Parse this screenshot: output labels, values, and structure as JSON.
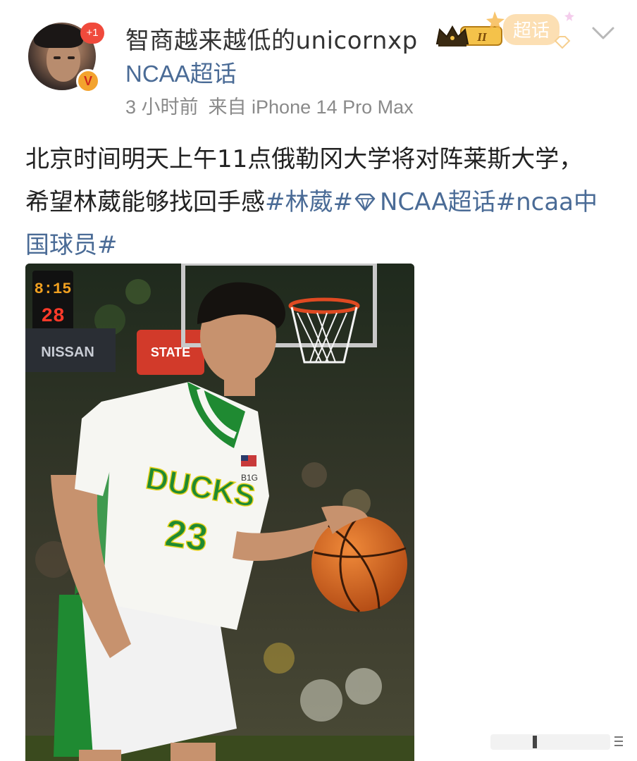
{
  "header": {
    "avatar_badge": "+1",
    "verified_badge": "V",
    "username": "智商越来越低的unicornxp",
    "crown_level": "II",
    "supertopic_tag": "超话",
    "topic": "NCAA超话",
    "time": "3 小时前",
    "source": "来自 iPhone 14 Pro Max"
  },
  "post": {
    "text": "北京时间明天上午11点俄勒冈大学将对阵莱斯大学，希望林葳能够找回手感",
    "tag1": "#林葳#",
    "tag2": "NCAA超话#ncaa中国球员#"
  },
  "photo": {
    "scoreboard_top": "8:15",
    "scoreboard_bottom": "28",
    "sponsor_1": "NISSAN",
    "sponsor_2": "STATE",
    "jersey_text": "DUCKS",
    "jersey_number": "23",
    "chest_logo": "B1G"
  },
  "colors": {
    "link": "#4a6b96",
    "meta": "#8a8a8a",
    "jersey_green": "#1f8a32",
    "jersey_yellow": "#e6d21c"
  },
  "icons": {
    "crown": "crown-icon",
    "supertopic": "supertopic-icon",
    "chevron": "chevron-down-icon",
    "gem": "gem-icon"
  }
}
